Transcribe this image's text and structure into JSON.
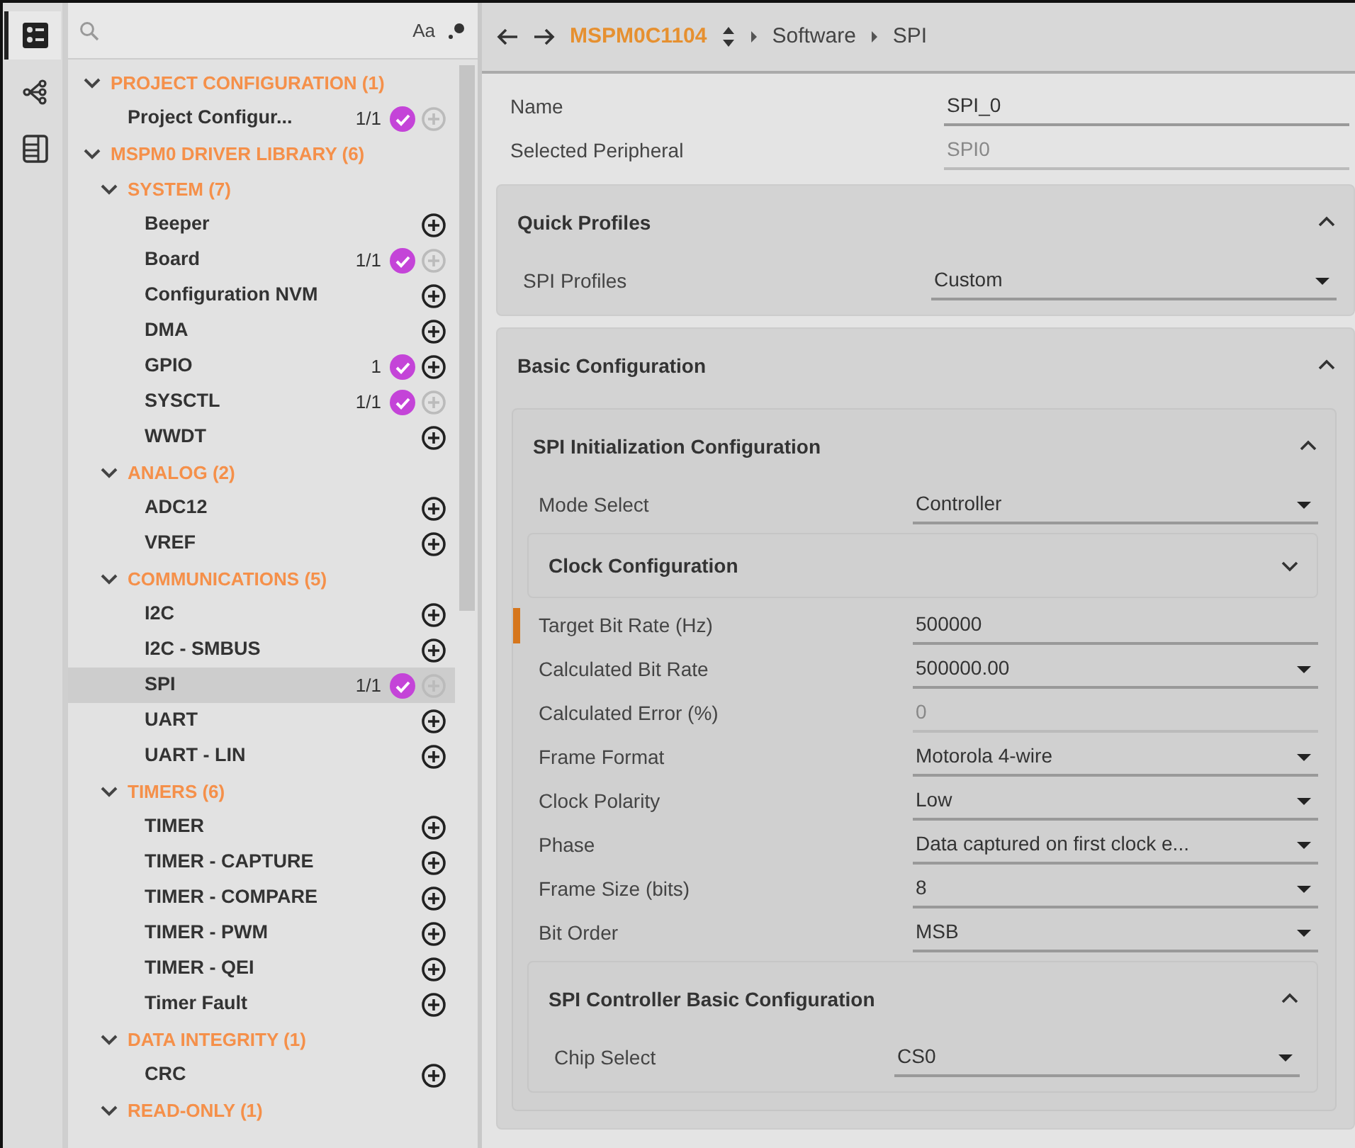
{
  "rail": [
    {
      "selected": true
    },
    {
      "selected": false
    },
    {
      "selected": false
    }
  ],
  "search": {
    "case_toggle": "Aa"
  },
  "tree": [
    {
      "label": "PROJECT CONFIGURATION (1)",
      "expanded": true,
      "children": [
        {
          "label": "Project Configur...",
          "count": "1/1",
          "configured": true,
          "can_add": false,
          "selected": false
        }
      ]
    },
    {
      "label": "MSPM0 DRIVER LIBRARY (6)",
      "expanded": true,
      "children": [
        {
          "label": "SYSTEM (7)",
          "expanded": true,
          "children": [
            {
              "label": "Beeper",
              "configured": false,
              "can_add": true,
              "selected": false
            },
            {
              "label": "Board",
              "count": "1/1",
              "configured": true,
              "can_add": false,
              "selected": false
            },
            {
              "label": "Configuration NVM",
              "configured": false,
              "can_add": true,
              "selected": false
            },
            {
              "label": "DMA",
              "configured": false,
              "can_add": true,
              "selected": false
            },
            {
              "label": "GPIO",
              "count": "1",
              "configured": true,
              "can_add": true,
              "selected": false
            },
            {
              "label": "SYSCTL",
              "count": "1/1",
              "configured": true,
              "can_add": false,
              "selected": false
            },
            {
              "label": "WWDT",
              "configured": false,
              "can_add": true,
              "selected": false
            }
          ]
        },
        {
          "label": "ANALOG (2)",
          "expanded": true,
          "children": [
            {
              "label": "ADC12",
              "configured": false,
              "can_add": true,
              "selected": false
            },
            {
              "label": "VREF",
              "configured": false,
              "can_add": true,
              "selected": false
            }
          ]
        },
        {
          "label": "COMMUNICATIONS (5)",
          "expanded": true,
          "children": [
            {
              "label": "I2C",
              "configured": false,
              "can_add": true,
              "selected": false
            },
            {
              "label": "I2C - SMBUS",
              "configured": false,
              "can_add": true,
              "selected": false
            },
            {
              "label": "SPI",
              "count": "1/1",
              "configured": true,
              "can_add": false,
              "selected": true
            },
            {
              "label": "UART",
              "configured": false,
              "can_add": true,
              "selected": false
            },
            {
              "label": "UART - LIN",
              "configured": false,
              "can_add": true,
              "selected": false
            }
          ]
        },
        {
          "label": "TIMERS (6)",
          "expanded": true,
          "children": [
            {
              "label": "TIMER",
              "configured": false,
              "can_add": true,
              "selected": false
            },
            {
              "label": "TIMER - CAPTURE",
              "configured": false,
              "can_add": true,
              "selected": false
            },
            {
              "label": "TIMER - COMPARE",
              "configured": false,
              "can_add": true,
              "selected": false
            },
            {
              "label": "TIMER - PWM",
              "configured": false,
              "can_add": true,
              "selected": false
            },
            {
              "label": "TIMER - QEI",
              "configured": false,
              "can_add": true,
              "selected": false
            },
            {
              "label": "Timer Fault",
              "configured": false,
              "can_add": true,
              "selected": false
            }
          ]
        },
        {
          "label": "DATA INTEGRITY (1)",
          "expanded": true,
          "children": [
            {
              "label": "CRC",
              "configured": false,
              "can_add": true,
              "selected": false
            }
          ]
        },
        {
          "label": "READ-ONLY (1)",
          "expanded": true
        }
      ]
    }
  ],
  "header": {
    "device": "MSPM0C1104",
    "breadcrumb": [
      "Software",
      "SPI"
    ]
  },
  "top_fields": [
    {
      "kind": "text",
      "label": "Name",
      "value": "SPI_0",
      "highlighted": false
    },
    {
      "kind": "readonly",
      "label": "Selected Peripheral",
      "value": "SPI0",
      "highlighted": false
    }
  ],
  "sections": [
    {
      "title": "Quick Profiles",
      "expanded": true,
      "items": [
        {
          "kind": "select",
          "label": "SPI Profiles",
          "value": "Custom",
          "highlighted": false
        }
      ]
    },
    {
      "title": "Basic Configuration",
      "expanded": true,
      "items": [
        {
          "kind": "section",
          "title": "SPI Initialization Configuration",
          "expanded": true,
          "items": [
            {
              "kind": "select",
              "label": "Mode Select",
              "value": "Controller",
              "highlighted": false
            },
            {
              "kind": "section",
              "title": "Clock Configuration",
              "expanded": false
            },
            {
              "kind": "text",
              "label": "Target Bit Rate (Hz)",
              "value": "500000",
              "highlighted": true
            },
            {
              "kind": "select",
              "label": "Calculated Bit Rate",
              "value": "500000.00",
              "highlighted": false
            },
            {
              "kind": "readonly",
              "label": "Calculated Error (%)",
              "value": "0",
              "highlighted": false
            },
            {
              "kind": "select",
              "label": "Frame Format",
              "value": "Motorola 4-wire",
              "highlighted": false
            },
            {
              "kind": "select",
              "label": "Clock Polarity",
              "value": "Low",
              "highlighted": false
            },
            {
              "kind": "select",
              "label": "Phase",
              "value": "Data captured on first clock e...",
              "highlighted": false
            },
            {
              "kind": "select",
              "label": "Frame Size (bits)",
              "value": "8",
              "highlighted": false
            },
            {
              "kind": "select",
              "label": "Bit Order",
              "value": "MSB",
              "highlighted": false
            },
            {
              "kind": "section",
              "title": "SPI Controller Basic Configuration",
              "expanded": true,
              "items": [
                {
                  "kind": "select",
                  "label": "Chip Select",
                  "value": "CS0",
                  "highlighted": false
                }
              ]
            }
          ]
        }
      ]
    }
  ]
}
